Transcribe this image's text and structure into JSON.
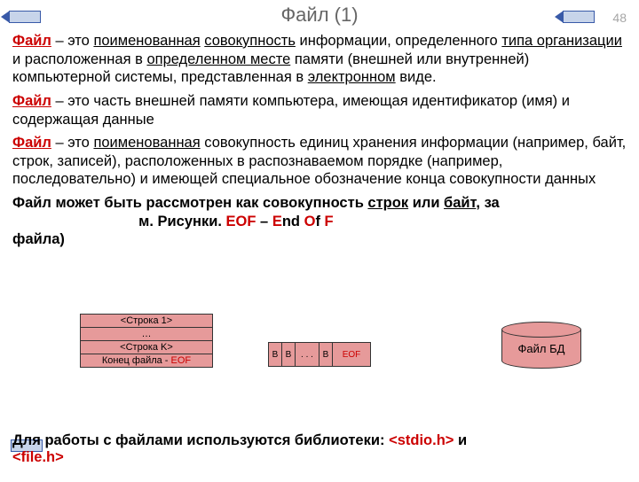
{
  "page_number": "48",
  "title": "Файл (1)",
  "para1": {
    "kw": "Файл",
    "dash": " – это ",
    "u1": "поименованная",
    "sp1": " ",
    "u2": "совокупность",
    "t1": " информации, определенного ",
    "u3": "типа организации",
    "t2": " и расположенная в ",
    "u4": "определенном месте",
    "t3": " памяти (внешней или внутренней) компьютерной системы, представленная в ",
    "u5": "электронном",
    "t4": " виде."
  },
  "para2": {
    "kw": "Файл",
    "t": " – это часть внешней памяти компьютера, имеющая идентификатор (имя) и содержащая данные"
  },
  "para3": {
    "kw": "Файл",
    "dash": " – это ",
    "u1": "поименованная",
    "t": " совокупность единиц хранения информации (например, байт, строк, записей), расположенных в распознаваемом порядке (например, последовательно) и имеющей специальное обозначение конца совокупности данных"
  },
  "para4": {
    "t1": "Файл может быть рассмотрен как совокупность ",
    "u1": "строк",
    "t2": " или ",
    "u2": "байт",
    "t3": ", за",
    "gap1": "                               ",
    "t4": "м. Рисунки. ",
    "eof1": "EOF",
    "t5": " – ",
    "e1": "E",
    "t6": "nd ",
    "o1": "O",
    "t7": "f ",
    "f1": "F",
    "gap2": "                    ",
    "t8": "файла)"
  },
  "stringbox": {
    "r1": "<Строка 1>",
    "r2": "…",
    "r3": "<Строка K>",
    "r4a": "Конец файла - ",
    "r4b": "EOF"
  },
  "bytebox": {
    "b": "B",
    "dots": ". . .",
    "eof": "EOF"
  },
  "cylinder": {
    "label": "Файл БД"
  },
  "footer": {
    "t1": "Для работы с файлами используются библиотеки: ",
    "lib1": "<stdio.h>",
    "t2": " и ",
    "lib2": "<file.h>"
  }
}
